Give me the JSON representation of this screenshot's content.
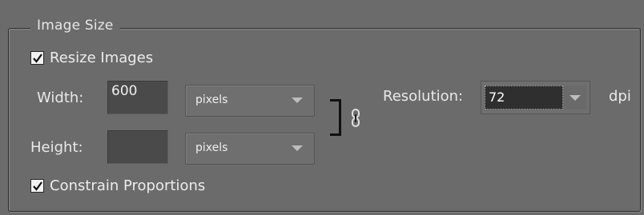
{
  "group": {
    "title": "Image Size"
  },
  "resize_images": {
    "label": "Resize Images",
    "checked": true
  },
  "width": {
    "label": "Width:",
    "value": "600",
    "unit": "pixels"
  },
  "height": {
    "label": "Height:",
    "value": "",
    "unit": "pixels"
  },
  "resolution": {
    "label": "Resolution:",
    "value": "72",
    "unit": "dpi"
  },
  "constrain": {
    "label": "Constrain Proportions",
    "checked": true
  },
  "icons": {
    "link": "link-icon",
    "check": "checkmark-icon"
  }
}
